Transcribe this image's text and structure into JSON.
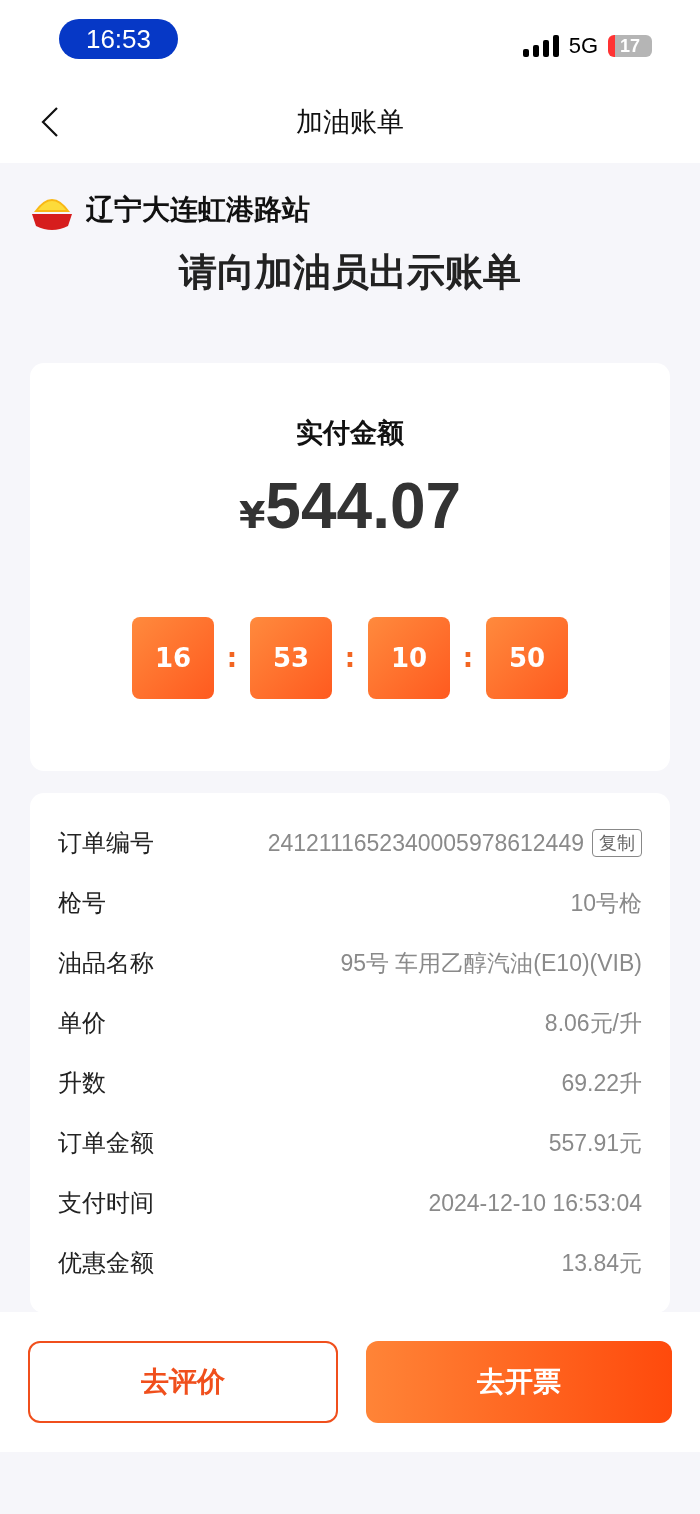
{
  "status_bar": {
    "time": "16:53",
    "network": "5G",
    "battery": "17"
  },
  "nav": {
    "title": "加油账单"
  },
  "station": {
    "name": "辽宁大连虹港路站"
  },
  "heading": "请向加油员出示账单",
  "payment": {
    "label": "实付金额",
    "currency": "¥",
    "amount": "544.07",
    "timer": [
      "16",
      "53",
      "10",
      "50"
    ],
    "separator": ":"
  },
  "details": [
    {
      "label": "订单编号",
      "value": "2412111652340005978612449",
      "action": "复制"
    },
    {
      "label": "枪号",
      "value": "10号枪"
    },
    {
      "label": "油品名称",
      "value": "95号 车用乙醇汽油(E10)(VIB)"
    },
    {
      "label": "单价",
      "value": "8.06元/升"
    },
    {
      "label": "升数",
      "value": "69.22升"
    },
    {
      "label": "订单金额",
      "value": "557.91元"
    },
    {
      "label": "支付时间",
      "value": "2024-12-10 16:53:04"
    },
    {
      "label": "优惠金额",
      "value": "13.84元"
    }
  ],
  "buttons": [
    {
      "label": "去评价",
      "kind": "outline"
    },
    {
      "label": "去开票",
      "kind": "filled"
    }
  ]
}
